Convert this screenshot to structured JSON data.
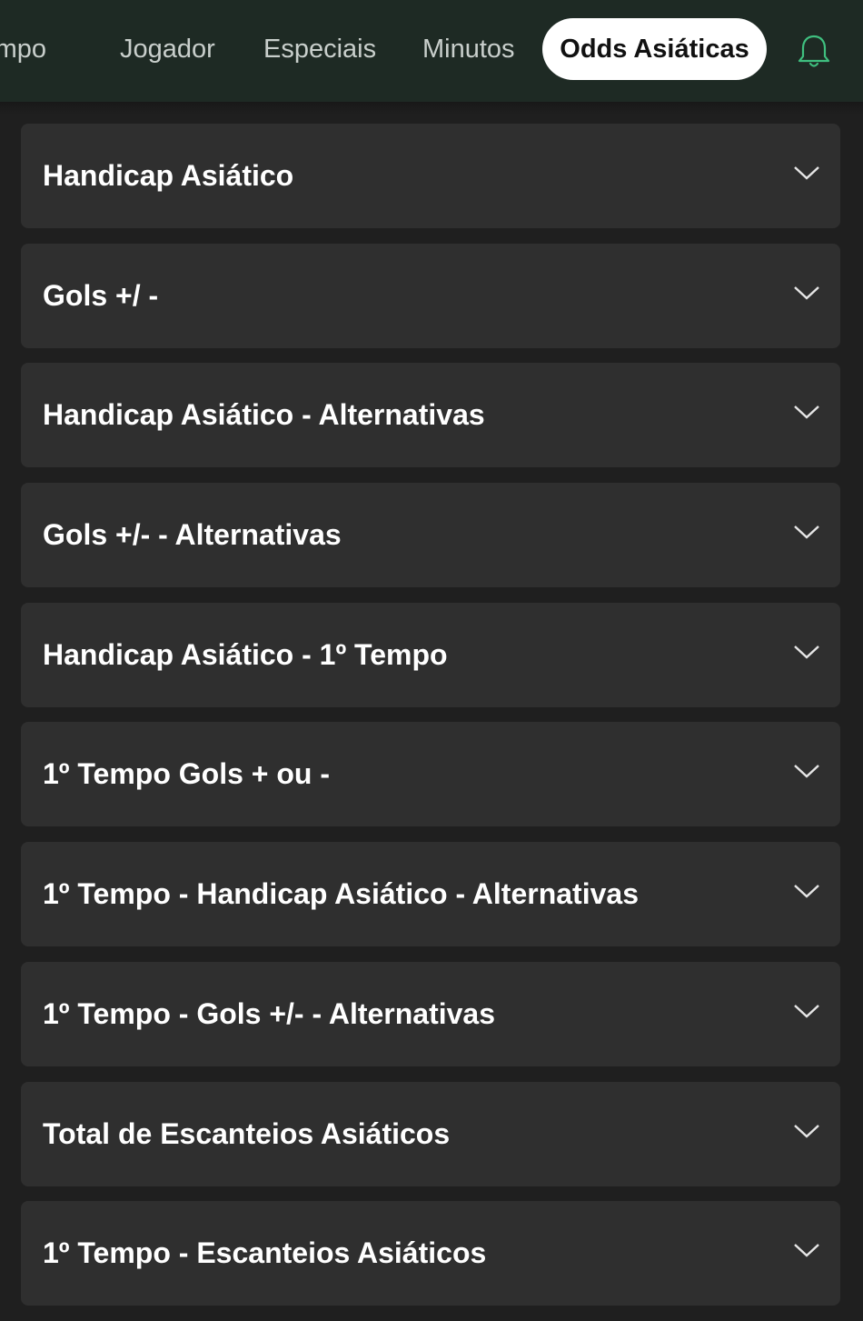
{
  "colors": {
    "topbar_bg": "#1e2a24",
    "page_bg": "#1f1f1f",
    "card_bg": "#2f2f2f",
    "active_tab_bg": "#ffffff",
    "bell_accent": "#3fbf7f"
  },
  "tabs": [
    {
      "label": "Tempo",
      "visible_fragment": "mpo"
    },
    {
      "label": "Jogador"
    },
    {
      "label": "Especiais"
    },
    {
      "label": "Minutos"
    },
    {
      "label": "Odds Asiáticas",
      "active": true
    }
  ],
  "header_icon": "bell-icon",
  "markets": [
    {
      "title": "Handicap Asiático"
    },
    {
      "title": "Gols +/ -"
    },
    {
      "title": "Handicap Asiático - Alternativas"
    },
    {
      "title": "Gols +/- - Alternativas"
    },
    {
      "title": "Handicap Asiático - 1º Tempo"
    },
    {
      "title": "1º Tempo Gols + ou -"
    },
    {
      "title": "1º Tempo - Handicap Asiático - Alternativas"
    },
    {
      "title": "1º Tempo - Gols +/- - Alternativas"
    },
    {
      "title": "Total de Escanteios Asiáticos"
    },
    {
      "title": "1º Tempo - Escanteios Asiáticos"
    }
  ],
  "expand_icon": "chevron-down-icon"
}
